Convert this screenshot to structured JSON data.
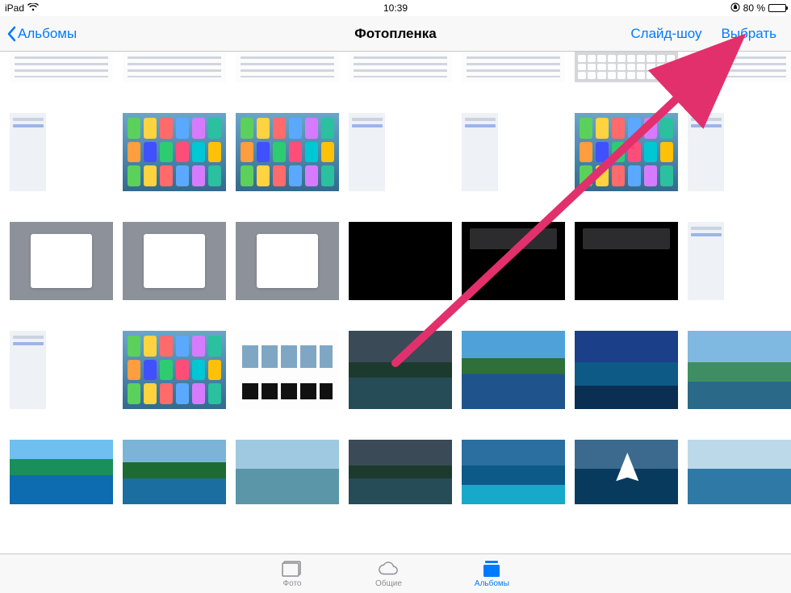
{
  "status": {
    "device": "iPad",
    "time": "10:39",
    "battery_pct": "80 %"
  },
  "nav": {
    "back_label": "Альбомы",
    "title": "Фотопленка",
    "slideshow": "Слайд-шоу",
    "select": "Выбрать"
  },
  "tabs": {
    "photos": "Фото",
    "shared": "Общие",
    "albums": "Альбомы"
  },
  "annotation": {
    "arrow_color": "#e2306c",
    "target": "select-button"
  },
  "grid": {
    "rows": [
      {
        "height": "partial",
        "items": [
          {
            "kind": "settings-rows"
          },
          {
            "kind": "settings-rows"
          },
          {
            "kind": "settings-rows"
          },
          {
            "kind": "settings-rows"
          },
          {
            "kind": "settings-rows"
          },
          {
            "kind": "keyboard"
          },
          {
            "kind": "settings-rows"
          }
        ]
      },
      {
        "height": "a",
        "items": [
          {
            "kind": "settings-light"
          },
          {
            "kind": "homescreen"
          },
          {
            "kind": "homescreen"
          },
          {
            "kind": "settings-light"
          },
          {
            "kind": "settings-light"
          },
          {
            "kind": "homescreen"
          },
          {
            "kind": "settings-light"
          }
        ]
      },
      {
        "height": "b",
        "items": [
          {
            "kind": "dialog"
          },
          {
            "kind": "dialog"
          },
          {
            "kind": "dialog"
          },
          {
            "kind": "dark"
          },
          {
            "kind": "dark-box"
          },
          {
            "kind": "dark-box"
          },
          {
            "kind": "settings-light"
          }
        ]
      },
      {
        "height": "c",
        "items": [
          {
            "kind": "settings-light"
          },
          {
            "kind": "homescreen"
          },
          {
            "kind": "wallpapers"
          },
          {
            "kind": "land-1"
          },
          {
            "kind": "land-2"
          },
          {
            "kind": "land-3"
          },
          {
            "kind": "land-4"
          }
        ]
      },
      {
        "height": "d",
        "items": [
          {
            "kind": "land-5"
          },
          {
            "kind": "land-10"
          },
          {
            "kind": "land-7"
          },
          {
            "kind": "land-1"
          },
          {
            "kind": "land-6"
          },
          {
            "kind": "land-9"
          },
          {
            "kind": "land-8"
          }
        ]
      }
    ]
  }
}
